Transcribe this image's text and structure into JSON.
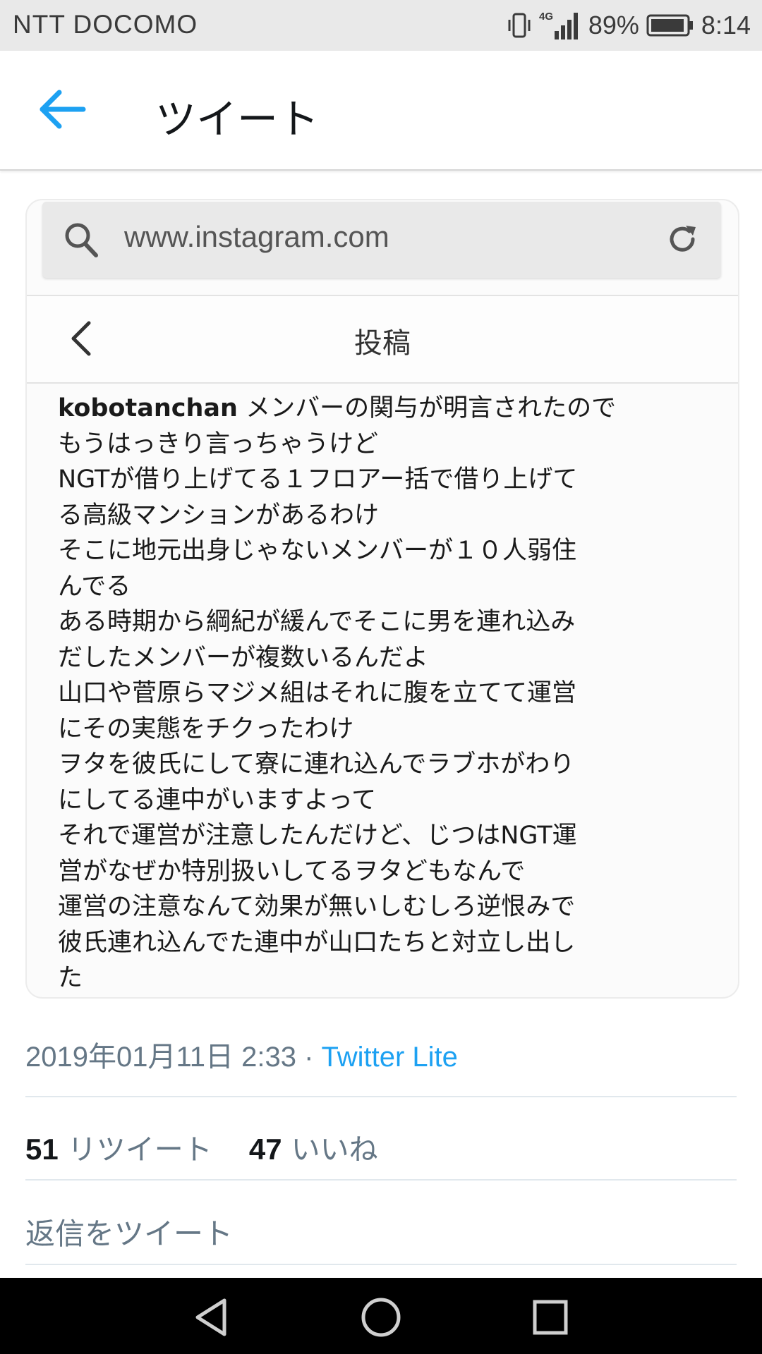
{
  "status_bar": {
    "carrier": "NTT DOCOMO",
    "network": "4G",
    "battery": "89%",
    "time": "8:14"
  },
  "header": {
    "title": "ツイート",
    "back_icon": "arrow-left-icon",
    "accent_color": "#1da1f2"
  },
  "embedded_image": {
    "url": "www.instagram.com",
    "page_title": "投稿",
    "username": "kobotanchan",
    "caption_lines": [
      " メンバーの関与が明言されたので",
      "もうはっきり言っちゃうけど",
      "NGTが借り上げてる１フロアー括で借り上げて",
      "る高級マンションがあるわけ",
      "そこに地元出身じゃないメンバーが１０人弱住",
      "んでる",
      "ある時期から綱紀が緩んでそこに男を連れ込み",
      "だしたメンバーが複数いるんだよ",
      "山口や菅原らマジメ組はそれに腹を立てて運営",
      "にその実態をチクったわけ",
      "ヲタを彼氏にして寮に連れ込んでラブホがわり",
      "にしてる連中がいますよって",
      "それで運営が注意したんだけど、じつはNGT運",
      "営がなぜか特別扱いしてるヲタどもなんで",
      "運営の注意なんて効果が無いしむしろ逆恨みで",
      "彼氏連れ込んでた連中が山口たちと対立し出し",
      "た"
    ]
  },
  "tweet_meta": {
    "timestamp": "2019年01月11日 2:33 · ",
    "source": "Twitter Lite"
  },
  "stats": {
    "retweets_count": "51",
    "retweets_label": "リツイート",
    "likes_count": "47",
    "likes_label": "いいね"
  },
  "reply": {
    "placeholder": "返信をツイート"
  }
}
